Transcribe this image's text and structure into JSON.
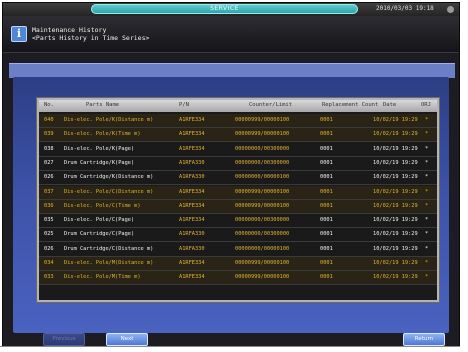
{
  "status_bar": {
    "label": "SERVICE",
    "datetime": "2010/03/03 19:18"
  },
  "header": {
    "icon": "info-icon",
    "title_line1": "Maintenance History",
    "title_line2": "<Parts History in Time Series>"
  },
  "table": {
    "columns": {
      "no": "No.",
      "name": "Parts Name",
      "pn": "P/N",
      "counter": "Counter/Limit",
      "replacement": "Replacement Count",
      "date": "Date",
      "orj": "ORJ"
    },
    "rows": [
      {
        "no": "040",
        "name": "Dis-elec. Pole/K(Distance m)",
        "pn": "A1RFE334",
        "counter": "00000999/00000100",
        "repl": "0001",
        "date": "10/02/19 19:29",
        "orj": "*",
        "hl": true
      },
      {
        "no": "039",
        "name": "Dis-elec. Pole/K(Time m)",
        "pn": "A1RFE334",
        "counter": "00000999/00000100",
        "repl": "0001",
        "date": "10/02/19 19:29",
        "orj": "*",
        "hl": true
      },
      {
        "no": "038",
        "name": "Dis-elec. Pole/K(Page)",
        "pn": "A1RFE334",
        "counter": "00000000/00300000",
        "repl": "0001",
        "date": "10/02/19 19:29",
        "orj": "*",
        "hl": false
      },
      {
        "no": "027",
        "name": "Drum Cartridge/K(Page)",
        "pn": "A1RFA330",
        "counter": "00000000/00300000",
        "repl": "0001",
        "date": "10/02/19 19:29",
        "orj": "*",
        "hl": false
      },
      {
        "no": "026",
        "name": "Drum Cartridge/K(Distance m)",
        "pn": "A1RFA330",
        "counter": "00000000/00000100",
        "repl": "0001",
        "date": "10/02/19 19:29",
        "orj": "*",
        "hl": false
      },
      {
        "no": "037",
        "name": "Dis-elec. Pole/C(Distance m)",
        "pn": "A1RFE334",
        "counter": "00000999/00000100",
        "repl": "0001",
        "date": "10/02/19 19:29",
        "orj": "*",
        "hl": true
      },
      {
        "no": "036",
        "name": "Dis-elec. Pole/C(Time m)",
        "pn": "A1RFE334",
        "counter": "00000999/00000100",
        "repl": "0001",
        "date": "10/02/19 19:29",
        "orj": "*",
        "hl": true
      },
      {
        "no": "035",
        "name": "Dis-elec. Pole/C(Page)",
        "pn": "A1RFE334",
        "counter": "00000000/00300000",
        "repl": "0001",
        "date": "10/02/19 19:29",
        "orj": "*",
        "hl": false
      },
      {
        "no": "025",
        "name": "Drum Cartridge/C(Page)",
        "pn": "A1RFA330",
        "counter": "00000000/00300000",
        "repl": "0001",
        "date": "10/02/19 19:29",
        "orj": "*",
        "hl": false
      },
      {
        "no": "026",
        "name": "Drum Cartridge/C(Distance m)",
        "pn": "A1RFA330",
        "counter": "00000000/00000100",
        "repl": "0001",
        "date": "10/02/19 19:29",
        "orj": "*",
        "hl": false
      },
      {
        "no": "034",
        "name": "Dis-elec. Pole/M(Distance m)",
        "pn": "A1RFE334",
        "counter": "00000999/00000100",
        "repl": "0001",
        "date": "10/02/19 19:29",
        "orj": "*",
        "hl": true
      },
      {
        "no": "033",
        "name": "Dis-elec. Pole/M(Time m)",
        "pn": "A1RFE334",
        "counter": "00000999/00000100",
        "repl": "0001",
        "date": "10/02/19 19:29",
        "orj": "*",
        "hl": true
      }
    ]
  },
  "buttons": {
    "prev": "Previous",
    "next": "Next",
    "return": "Return"
  },
  "colors": {
    "highlight_text": "#e1b232",
    "normal_text": "#f2f2f2",
    "panel": "#3d52a8",
    "accent": "#4f77d2"
  }
}
